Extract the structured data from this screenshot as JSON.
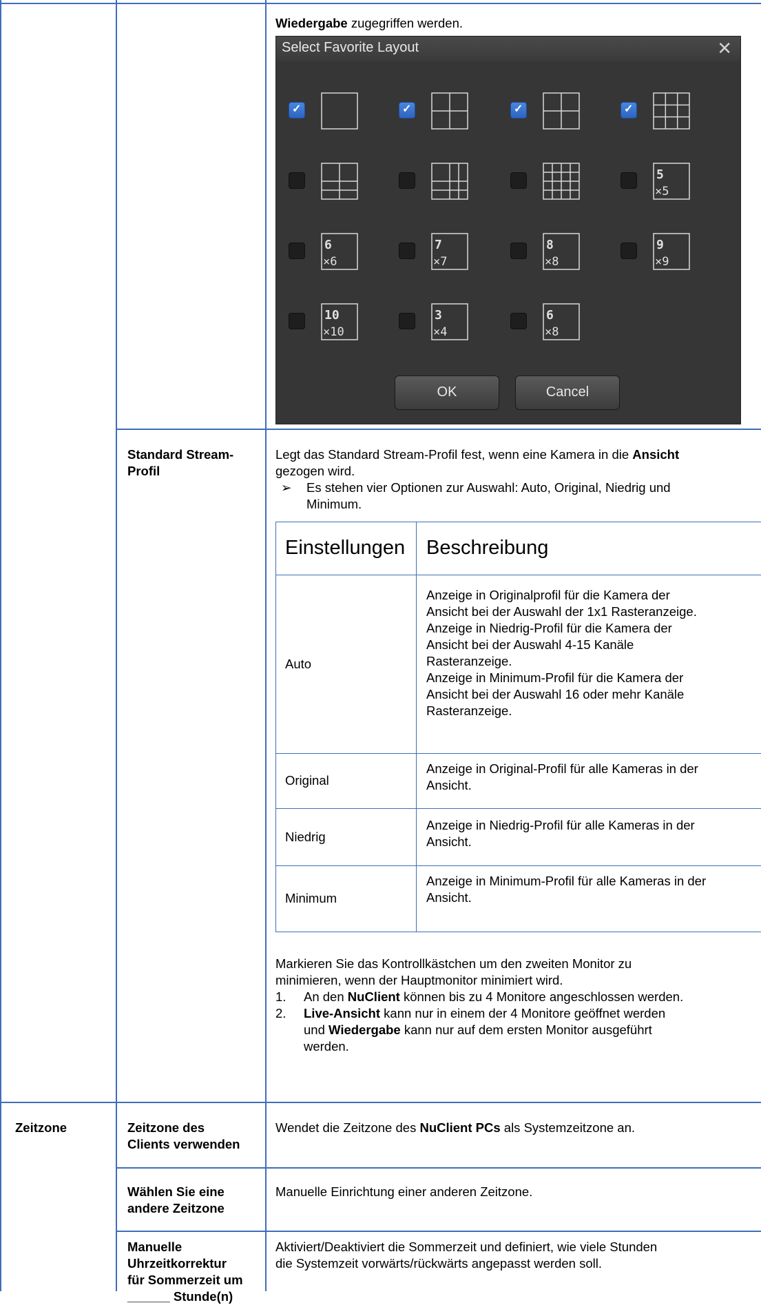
{
  "top_note": {
    "bold": "Wiedergabe",
    "rest": " zugegriffen werden."
  },
  "dialog": {
    "title": "Select Favorite Layout",
    "close_glyph": "✕",
    "layouts": [
      {
        "label": "",
        "checked": true
      },
      {
        "label": "",
        "checked": true
      },
      {
        "label": "",
        "checked": true
      },
      {
        "label": "",
        "checked": true
      },
      {
        "label": "",
        "checked": false
      },
      {
        "label": "",
        "checked": false
      },
      {
        "label": "",
        "checked": false
      },
      {
        "label": "5×5",
        "checked": false
      },
      {
        "label": "6×6",
        "checked": false
      },
      {
        "label": "7×7",
        "checked": false
      },
      {
        "label": "8×8",
        "checked": false
      },
      {
        "label": "9×9",
        "checked": false
      },
      {
        "label": "10×10",
        "checked": false
      },
      {
        "label": "3×4",
        "checked": false
      },
      {
        "label": "6×8",
        "checked": false
      }
    ],
    "ok_label": "OK",
    "cancel_label": "Cancel"
  },
  "stream": {
    "name_line1": "Standard Stream-",
    "name_line2": "Profil",
    "desc_pre": "Legt das Standard Stream-Profil fest, wenn eine Kamera in die ",
    "desc_bold": "Ansicht",
    "desc_line2": "gezogen wird.",
    "bullet_marker": "➢",
    "bullet_line1": "Es stehen vier Optionen zur Auswahl: Auto, Original, Niedrig und",
    "bullet_line2": "Minimum.",
    "table": {
      "headers": [
        "Einstellungen",
        "Beschreibung"
      ],
      "rows": [
        {
          "setting": "Auto",
          "lines": [
            "Anzeige in Originalprofil für die Kamera der",
            "Ansicht bei der Auswahl der 1x1 Rasteranzeige.",
            "Anzeige in Niedrig-Profil für die Kamera der",
            "Ansicht bei der Auswahl 4-15 Kanäle",
            "Rasteranzeige.",
            "Anzeige in Minimum-Profil für die Kamera der",
            "Ansicht bei der Auswahl 16 oder mehr Kanäle",
            "Rasteranzeige."
          ]
        },
        {
          "setting": "Original",
          "lines": [
            "Anzeige in Original-Profil für alle Kameras in der",
            "Ansicht."
          ]
        },
        {
          "setting": "Niedrig",
          "lines": [
            "Anzeige in Niedrig-Profil für alle Kameras in der",
            "Ansicht."
          ]
        },
        {
          "setting": "Minimum",
          "lines": [
            "Anzeige in Minimum-Profil für alle Kameras in der",
            "Ansicht."
          ]
        }
      ]
    },
    "monitor_line1": "Markieren Sie das Kontrollkästchen um den zweiten Monitor zu",
    "monitor_line2": "minimieren, wenn der Hauptmonitor minimiert wird.",
    "n1": "1.",
    "item1_pre": "An den ",
    "item1_bold": "NuClient",
    "item1_post": " können bis zu 4 Monitore angeschlossen werden.",
    "n2": "2.",
    "item2_bold1": "Live-Ansicht",
    "item2_mid": " kann nur in einem der 4 Monitore geöffnet werden",
    "item2_line2_pre": "und ",
    "item2_bold2": "Wiedergabe",
    "item2_line2_post": " kann nur auf dem ersten Monitor ausgeführt",
    "item2_line3": "werden."
  },
  "zeitzone": {
    "category": "Zeitzone",
    "rows": [
      {
        "name_lines": [
          "Zeitzone des",
          "Clients verwenden"
        ],
        "desc_pre": "Wendet die Zeitzone des ",
        "desc_bold": "NuClient PCs",
        "desc_post": " als Systemzeitzone an."
      },
      {
        "name_lines": [
          "Wählen Sie eine",
          "andere Zeitzone"
        ],
        "desc": "Manuelle Einrichtung einer anderen Zeitzone."
      },
      {
        "name_lines": [
          "Manuelle",
          "Uhrzeitkorrektur",
          "für Sommerzeit um",
          "______ Stunde(n)"
        ],
        "desc_lines": [
          "Aktiviert/Deaktiviert die Sommerzeit und definiert, wie viele Stunden",
          "die Systemzeit vorwärts/rückwärts angepasst werden soll."
        ]
      }
    ]
  }
}
